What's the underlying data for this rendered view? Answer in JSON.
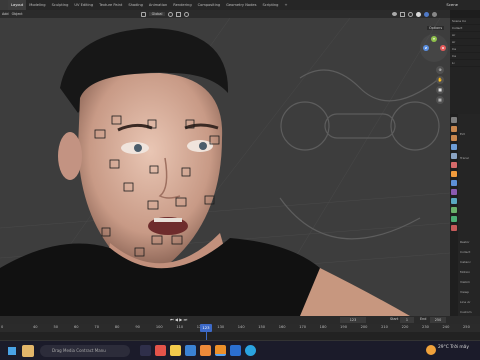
{
  "workspace_tabs": [
    "Layout",
    "Modeling",
    "Sculpting",
    "UV Editing",
    "Texture Paint",
    "Shading",
    "Animation",
    "Rendering",
    "Compositing",
    "Geometry Nodes",
    "Scripting",
    "+"
  ],
  "scene_label": "Scene",
  "header": {
    "items": [
      "Add",
      "Object"
    ],
    "orientation": "Global"
  },
  "outliner": {
    "rows": [
      "Scene Co",
      "Collect",
      "Ar",
      "Ar",
      "Ca",
      "Ca",
      "Li"
    ]
  },
  "properties": {
    "labels": [
      "Ext",
      "Transl",
      "Restor",
      "Collect",
      "Instanc",
      "Motion",
      "Visibili",
      "Viewp",
      "Line Ar",
      "Custom"
    ]
  },
  "navigation": {
    "options_label": "Options",
    "gizmo": {
      "x": "X",
      "y": "Y",
      "z": "Z"
    }
  },
  "timeline": {
    "start_label": "Start",
    "start_value": "1",
    "end_label": "End",
    "end_value": "250",
    "current_frame": "123",
    "ticks": [
      "0",
      "40",
      "50",
      "60",
      "70",
      "80",
      "90",
      "100",
      "110",
      "120",
      "123",
      "130",
      "140",
      "150",
      "160",
      "170",
      "180",
      "190",
      "200",
      "210",
      "220",
      "230",
      "240",
      "250"
    ]
  },
  "taskbar": {
    "search_placeholder": "Drag Media Contract Manu",
    "weather": "29°C  Trời mây"
  },
  "colors": {
    "accent": "#3d6ac8",
    "x_axis": "#e45a5a",
    "y_axis": "#8fc14b",
    "z_axis": "#5b8fe0"
  }
}
